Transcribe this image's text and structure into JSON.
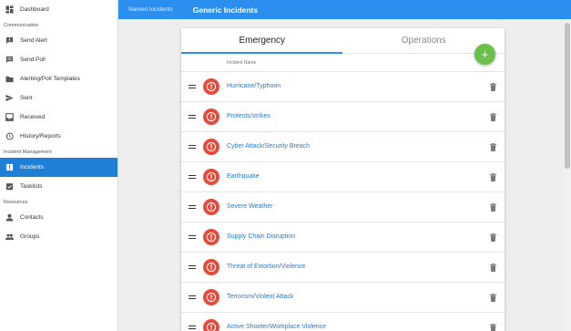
{
  "sidebar": {
    "dashboard": "Dashboard",
    "sections": {
      "communication": "Communication",
      "incident_management": "Incident Management",
      "resources": "Resources"
    },
    "items": {
      "send_alert": "Send Alert",
      "send_poll": "Send Poll",
      "templates": "Alerting/Poll Templates",
      "sent": "Sent",
      "received": "Received",
      "history": "History/Reports",
      "incidents": "Incidents",
      "tasklists": "Tasklists",
      "contacts": "Contacts",
      "groups": "Groups"
    },
    "active_color": "#1e7fd7"
  },
  "topbar": {
    "breadcrumb": "Named Incidents",
    "title": "Generic Incidents",
    "color": "#2b8ff0"
  },
  "tabs": [
    "Emergency",
    "Operations"
  ],
  "active_tab": "Emergency",
  "add_button": "+",
  "table": {
    "column_header": "Incident Name",
    "rows": [
      "Hurricane/Typhoon",
      "Protests/strikes",
      "Cyber Attack/Security Breach",
      "Earthquake",
      "Severe Weather",
      "Supply Chain Disruption",
      "Threat of Extortion/Violence",
      "Terrorism/Violent Attack",
      "Active Shooter/Workplace Violence"
    ],
    "icon": "alert-icon",
    "icon_color": "#e64a3b"
  }
}
